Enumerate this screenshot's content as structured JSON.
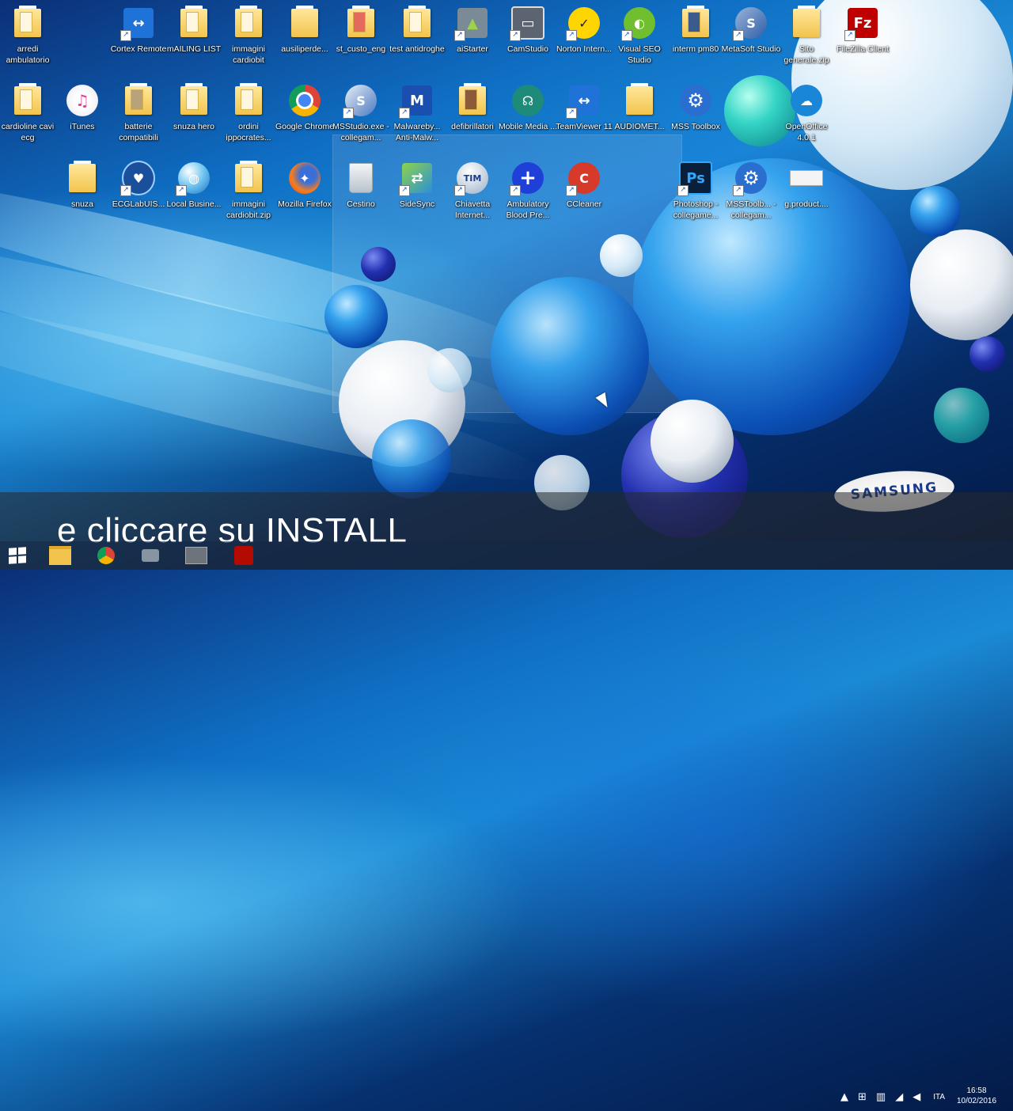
{
  "desktop": {
    "icons": [
      {
        "label": "arredi ambulatorio",
        "icon": "folder-icon"
      },
      {
        "label": "Cortex Remote",
        "icon": "teamviewer-icon"
      },
      {
        "label": "mAILING LIST",
        "icon": "folder-icon"
      },
      {
        "label": "immagini cardiobit",
        "icon": "folder-icon"
      },
      {
        "label": "ausiliperde...",
        "icon": "folder-icon"
      },
      {
        "label": "st_custo_eng",
        "icon": "folder-icon"
      },
      {
        "label": "test antidroghe",
        "icon": "folder-icon"
      },
      {
        "label": "aiStarter",
        "icon": "android-icon"
      },
      {
        "label": "CamStudio",
        "icon": "camstudio-icon"
      },
      {
        "label": "Norton Intern...",
        "icon": "norton-icon"
      },
      {
        "label": "Visual SEO Studio",
        "icon": "chameleon-icon"
      },
      {
        "label": "interm pm80",
        "icon": "folder-icon"
      },
      {
        "label": "MetaSoft Studio",
        "icon": "metasoft-icon"
      },
      {
        "label": "Sito generale.zip",
        "icon": "zip-folder-icon"
      },
      {
        "label": "FileZilla Client",
        "icon": "filezilla-icon"
      },
      {
        "label": "cardioline cavi ecg",
        "icon": "folder-icon"
      },
      {
        "label": "iTunes",
        "icon": "itunes-icon"
      },
      {
        "label": "batterie compatibili",
        "icon": "folder-icon"
      },
      {
        "label": "snuza hero",
        "icon": "folder-icon"
      },
      {
        "label": "ordini ippocrates...",
        "icon": "folder-icon"
      },
      {
        "label": "Google Chrome",
        "icon": "chrome-icon"
      },
      {
        "label": "MSStudio.exe - collegam...",
        "icon": "msstudio-icon"
      },
      {
        "label": "Malwareby... Anti-Malw...",
        "icon": "malwarebytes-icon"
      },
      {
        "label": "defibrillatori",
        "icon": "folder-icon"
      },
      {
        "label": "Mobile Media ...",
        "icon": "mobile-media-icon"
      },
      {
        "label": "TeamViewer 11",
        "icon": "teamviewer-icon"
      },
      {
        "label": "AUDIOMET...",
        "icon": "folder-icon"
      },
      {
        "label": "MSS Toolbox",
        "icon": "gear-icon"
      },
      {
        "label": "OpenOffice 4.0.1",
        "icon": "openoffice-icon"
      },
      {
        "label": "snuza",
        "icon": "folder-icon"
      },
      {
        "label": "ECGLabUIS...",
        "icon": "ecglab-icon"
      },
      {
        "label": "Local Busine...",
        "icon": "globe-icon"
      },
      {
        "label": "immagini cardiobit.zip",
        "icon": "zip-folder-icon"
      },
      {
        "label": "Mozilla Firefox",
        "icon": "firefox-icon"
      },
      {
        "label": "Cestino",
        "icon": "recycle-bin-icon"
      },
      {
        "label": "SideSync",
        "icon": "sidesync-icon"
      },
      {
        "label": "Chiavetta Internet...",
        "icon": "tim-icon"
      },
      {
        "label": "Ambulatory Blood Pre...",
        "icon": "medical-cross-icon"
      },
      {
        "label": "CCleaner",
        "icon": "ccleaner-icon"
      },
      {
        "label": "Photoshop - collegame...",
        "icon": "photoshop-icon"
      },
      {
        "label": "MSSToolb... - collegam...",
        "icon": "gear-icon"
      },
      {
        "label": "g.product....",
        "icon": "document-icon"
      }
    ]
  },
  "overlay": {
    "caption": "e cliccare su INSTALL",
    "brand": "SAMSUNG"
  },
  "taskbar": {
    "items": [
      "start-icon",
      "file-explorer-icon",
      "chrome-icon",
      "camera-icon",
      "window-icon",
      "acrobat-icon"
    ],
    "tray": {
      "language": "ITA",
      "time": "16:58",
      "date": "10/02/2016"
    }
  },
  "colors": {
    "folder": "#f2c44d",
    "caption_bg": "#282828",
    "samsung_blue": "#1b3a8c"
  }
}
